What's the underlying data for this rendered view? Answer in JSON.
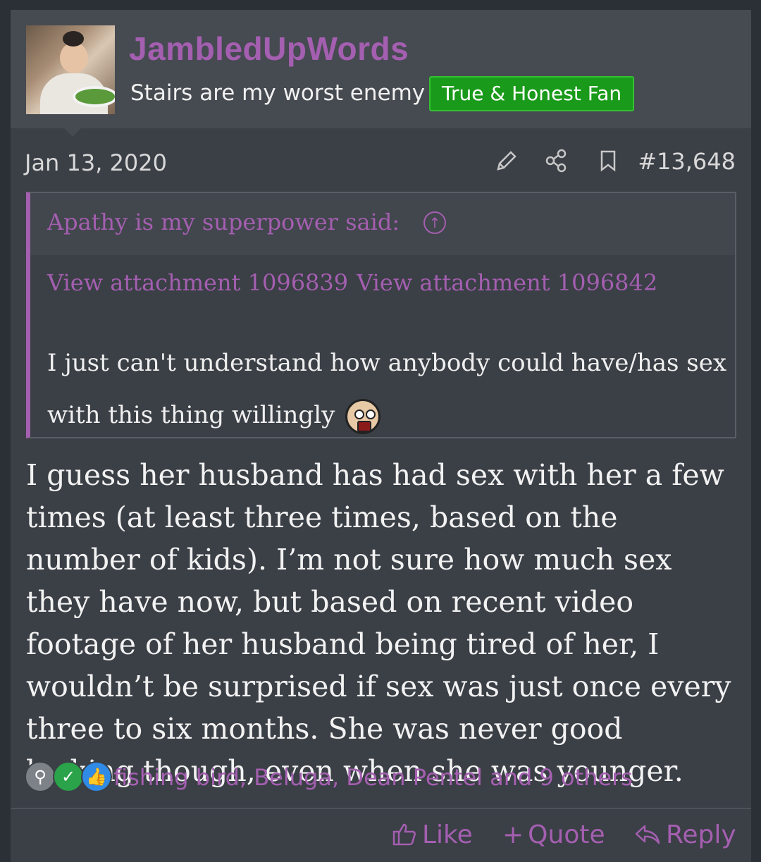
{
  "post": {
    "username": "JambledUpWords",
    "user_title": "Stairs are my worst enemy",
    "badge": "True & Honest Fan",
    "date": "Jan 13, 2020",
    "post_number": "#13,648",
    "quote": {
      "author": "Apathy is my superpower said:",
      "attachments": [
        "View attachment 1096839",
        "View attachment 1096842"
      ],
      "text": "I just can't understand how anybody could have/has sex with this thing willingly"
    },
    "body": "I guess her husband has had sex with her a few times (at least three times, based on the number of kids). I’m not sure how much sex they have now, but based on recent video footage of her husband being tired of her, I wouldn’t be surprised if sex was just once every three to six months. She was never good looking though, even when she was younger.",
    "reactions": {
      "icons": [
        "wrench-icon",
        "check-icon",
        "thumbs-up-icon"
      ],
      "names": "fishing bird, Beluga, Dean Pentel and 9 others"
    },
    "actions": {
      "like": "Like",
      "quote": "Quote",
      "reply": "Reply"
    }
  },
  "colors": {
    "accent": "#a45fb0",
    "badge_bg": "#1a9a1a",
    "background": "#3b3f46",
    "header_bg": "#464a51"
  }
}
